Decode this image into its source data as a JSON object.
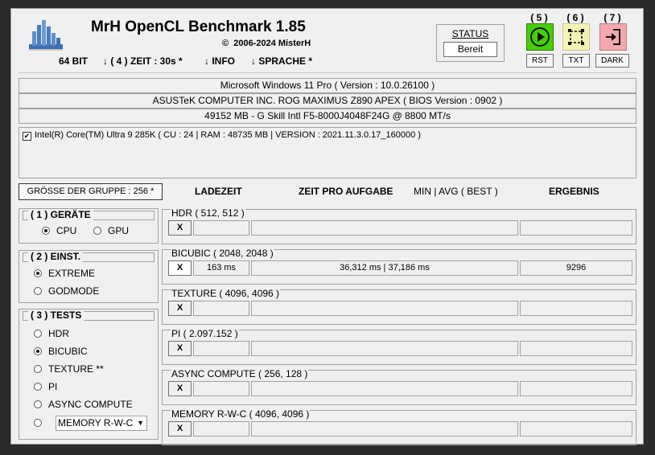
{
  "header": {
    "title": "MrH OpenCL Benchmark 1.85",
    "copyright_symbol": "©",
    "copyright": "2006-2024 MisterH",
    "menu": {
      "bits": "64 BIT",
      "zeit": "↓ ( 4 ) ZEIT : 30s *",
      "info": "↓ INFO",
      "sprache": "↓ SPRACHE *"
    }
  },
  "status": {
    "label": "STATUS",
    "value": "Bereit"
  },
  "action_buttons": [
    {
      "num": "( 5 )",
      "icon": "play-icon",
      "label": "RST"
    },
    {
      "num": "( 6 )",
      "icon": "selection-icon",
      "label": "TXT"
    },
    {
      "num": "( 7 )",
      "icon": "exit-icon",
      "label": "DARK"
    }
  ],
  "system": {
    "os": "Microsoft Windows 11 Pro ( Version : 10.0.26100 )",
    "board": "ASUSTeK COMPUTER INC. ROG MAXIMUS Z890 APEX ( BIOS Version : 0902 )",
    "memory": "49152 MB - G Skill Intl F5-8000J4048F24G    @ 8800 MT/s"
  },
  "cpu_device": {
    "checked": true,
    "label": "Intel(R) Core(TM) Ultra 9 285K ( CU : 24 | RAM : 48735 MB | VERSION : 2021.11.3.0.17_160000 )"
  },
  "group_size": "GRÖSSE DER GRUPPE : 256 *",
  "columns": {
    "load": "LADEZEIT",
    "time_per_task": "ZEIT PRO AUFGABE",
    "min_avg_best": "MIN | AVG ( BEST )",
    "result": "ERGEBNIS"
  },
  "devices_panel": {
    "title": "( 1 ) GERÄTE",
    "options": [
      {
        "label": "CPU",
        "selected": true
      },
      {
        "label": "GPU",
        "selected": false
      }
    ]
  },
  "settings_panel": {
    "title": "( 2 ) EINST.",
    "options": [
      {
        "label": "EXTREME",
        "selected": true
      },
      {
        "label": "GODMODE",
        "selected": false
      }
    ]
  },
  "tests_panel": {
    "title": "( 3 ) TESTS",
    "options": [
      {
        "label": "HDR",
        "selected": false
      },
      {
        "label": "BICUBIC",
        "selected": true
      },
      {
        "label": "TEXTURE **",
        "selected": false
      },
      {
        "label": "PI",
        "selected": false
      },
      {
        "label": "ASYNC COMPUTE",
        "selected": false
      }
    ],
    "last_option_select": "MEMORY R-W-C"
  },
  "tests": [
    {
      "title": "HDR ( 512, 512 )",
      "x": "X",
      "load": "",
      "time": "",
      "result": ""
    },
    {
      "title": "BICUBIC ( 2048, 2048 )",
      "x": "X",
      "load": "163 ms",
      "time": "36,312 ms | 37,186 ms",
      "result": "9296"
    },
    {
      "title": "TEXTURE ( 4096, 4096 )",
      "x": "X",
      "load": "",
      "time": "",
      "result": ""
    },
    {
      "title": "PI ( 2.097.152 )",
      "x": "X",
      "load": "",
      "time": "",
      "result": ""
    },
    {
      "title": "ASYNC COMPUTE ( 256, 128 )",
      "x": "X",
      "load": "",
      "time": "",
      "result": ""
    },
    {
      "title": "MEMORY R-W-C ( 4096, 4096 )",
      "x": "X",
      "load": "",
      "time": "",
      "result": ""
    }
  ]
}
